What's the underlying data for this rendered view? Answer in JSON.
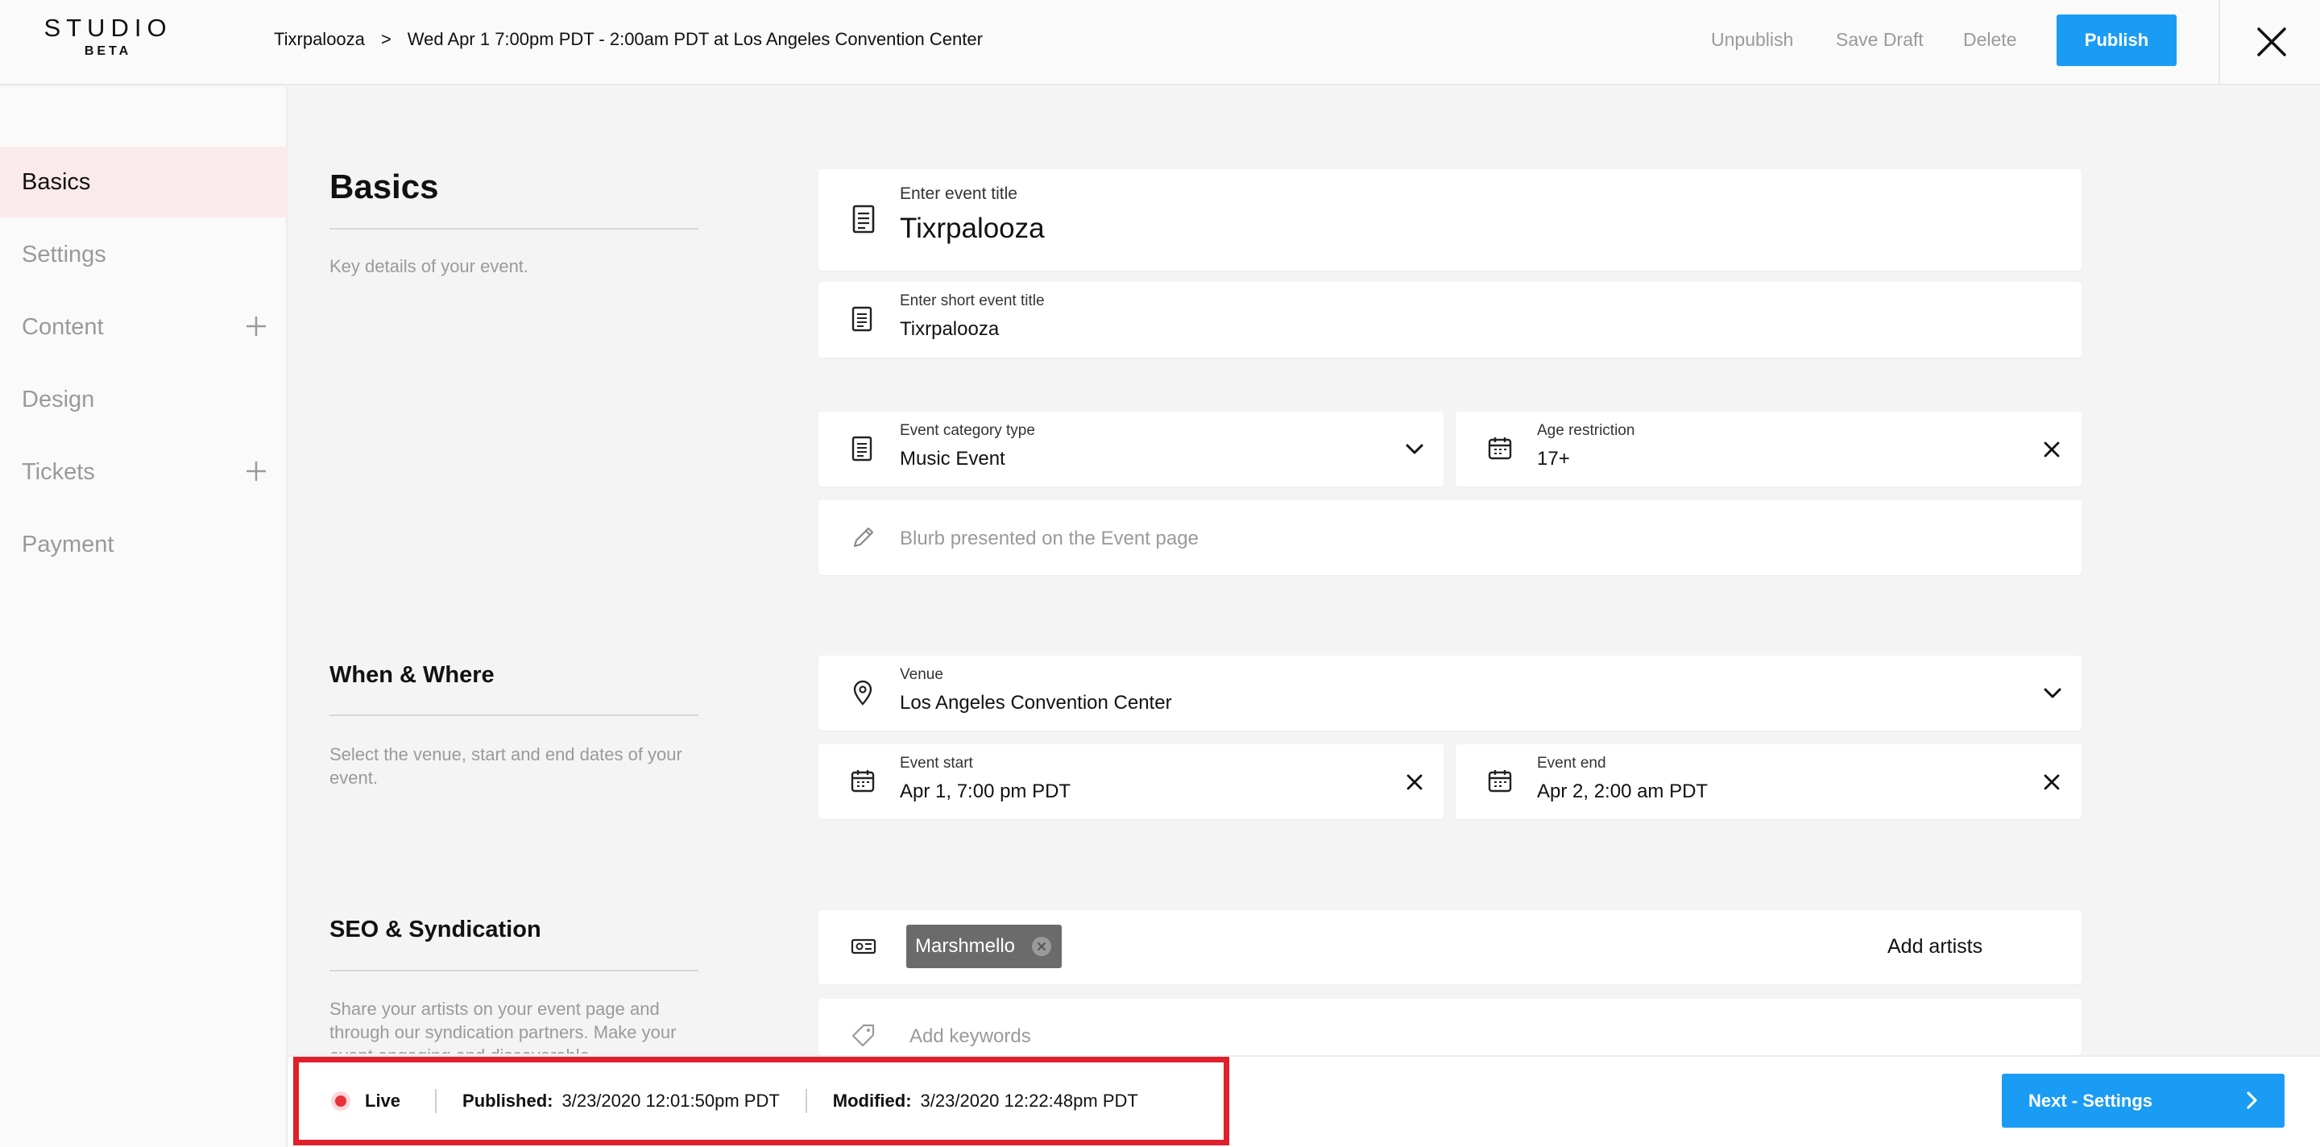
{
  "brand": {
    "name": "STUDIO",
    "tag": "BETA"
  },
  "breadcrumb": {
    "event": "Tixrpalooza",
    "separator": ">",
    "occurrence": "Wed Apr 1 7:00pm PDT - 2:00am PDT at Los Angeles Convention Center"
  },
  "actions": {
    "unpublish": "Unpublish",
    "save_draft": "Save Draft",
    "delete": "Delete",
    "publish": "Publish"
  },
  "sidebar": {
    "items": [
      {
        "label": "Basics",
        "active": true
      },
      {
        "label": "Settings"
      },
      {
        "label": "Content",
        "has_add": true
      },
      {
        "label": "Design"
      },
      {
        "label": "Tickets",
        "has_add": true
      },
      {
        "label": "Payment"
      }
    ]
  },
  "sections": {
    "basics": {
      "title": "Basics",
      "description": "Key details of your event."
    },
    "when_where": {
      "title": "When & Where",
      "description": "Select the venue, start and end dates of your event."
    },
    "seo": {
      "title": "SEO & Syndication",
      "description": "Share your artists on your event page and through our syndication partners. Make your event engaging and discoverable."
    }
  },
  "fields": {
    "title": {
      "label": "Enter event title",
      "value": "Tixrpalooza",
      "icon": "document-icon"
    },
    "short_title": {
      "label": "Enter short event title",
      "value": "Tixrpalooza",
      "icon": "document-icon"
    },
    "category": {
      "label": "Event category type",
      "value": "Music Event",
      "icon": "document-icon"
    },
    "age": {
      "label": "Age restriction",
      "value": "17+",
      "icon": "calendar-icon"
    },
    "blurb": {
      "placeholder": "Blurb presented on the Event page",
      "icon": "pencil-icon"
    },
    "venue": {
      "label": "Venue",
      "value": "Los Angeles Convention Center",
      "icon": "location-pin-icon"
    },
    "start": {
      "label": "Event start",
      "value": "Apr 1, 7:00 pm PDT",
      "icon": "calendar-icon"
    },
    "end": {
      "label": "Event end",
      "value": "Apr 2, 2:00 am PDT",
      "icon": "calendar-icon"
    },
    "artists": {
      "tag": "Marshmello",
      "placeholder": "Add artists",
      "icon": "ticket-icon"
    },
    "keywords": {
      "placeholder": "Add keywords",
      "icon": "tag-icon"
    }
  },
  "status": {
    "state": "Live",
    "published_label": "Published:",
    "published_value": "3/23/2020 12:01:50pm PDT",
    "modified_label": "Modified:",
    "modified_value": "3/23/2020 12:22:48pm PDT"
  },
  "next_button": "Next - Settings",
  "colors": {
    "accent": "#1a9cf4",
    "highlight": "#e0202a",
    "live": "#e8323a",
    "active_nav": "#fbeaec"
  }
}
